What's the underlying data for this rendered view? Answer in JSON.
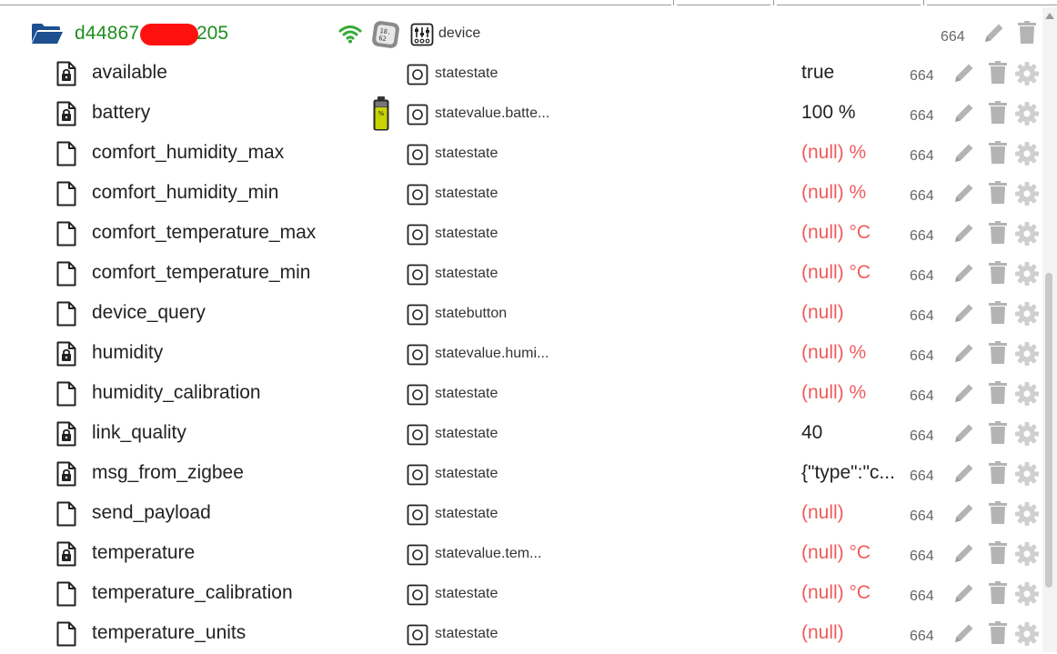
{
  "device": {
    "name_prefix": "d44867",
    "name_suffix": "205",
    "type_label": "device",
    "acl": "664",
    "icons": [
      "folder-open-icon",
      "wifi-icon",
      "sensor-display-icon",
      "device-type-icon",
      "edit-icon",
      "trash-icon"
    ],
    "colors": {
      "name": "#1f8f1f",
      "folder": "#1d4f91",
      "wifi": "#33aa33",
      "redaction": "#ff1010"
    }
  },
  "states": [
    {
      "name": "available",
      "locked": true,
      "role": "statestate",
      "value": "true",
      "value_null": false,
      "acl": "664"
    },
    {
      "name": "battery",
      "locked": true,
      "role": "statevalue.batte...",
      "value": "100 %",
      "value_null": false,
      "acl": "664",
      "icon": "battery-icon"
    },
    {
      "name": "comfort_humidity_max",
      "locked": false,
      "role": "statestate",
      "value": "(null) %",
      "value_null": true,
      "acl": "664"
    },
    {
      "name": "comfort_humidity_min",
      "locked": false,
      "role": "statestate",
      "value": "(null) %",
      "value_null": true,
      "acl": "664"
    },
    {
      "name": "comfort_temperature_max",
      "locked": false,
      "role": "statestate",
      "value": "(null) °C",
      "value_null": true,
      "acl": "664"
    },
    {
      "name": "comfort_temperature_min",
      "locked": false,
      "role": "statestate",
      "value": "(null) °C",
      "value_null": true,
      "acl": "664"
    },
    {
      "name": "device_query",
      "locked": false,
      "role": "statebutton",
      "value": "(null)",
      "value_null": true,
      "acl": "664"
    },
    {
      "name": "humidity",
      "locked": true,
      "role": "statevalue.humi...",
      "value": "(null) %",
      "value_null": true,
      "acl": "664"
    },
    {
      "name": "humidity_calibration",
      "locked": false,
      "role": "statestate",
      "value": "(null) %",
      "value_null": true,
      "acl": "664"
    },
    {
      "name": "link_quality",
      "locked": true,
      "role": "statestate",
      "value": "40",
      "value_null": false,
      "acl": "664"
    },
    {
      "name": "msg_from_zigbee",
      "locked": true,
      "role": "statestate",
      "value": "{\"type\":\"c...",
      "value_null": false,
      "acl": "664"
    },
    {
      "name": "send_payload",
      "locked": false,
      "role": "statestate",
      "value": "(null)",
      "value_null": true,
      "acl": "664"
    },
    {
      "name": "temperature",
      "locked": true,
      "role": "statevalue.tem...",
      "value": "(null) °C",
      "value_null": true,
      "acl": "664"
    },
    {
      "name": "temperature_calibration",
      "locked": false,
      "role": "statestate",
      "value": "(null) °C",
      "value_null": true,
      "acl": "664"
    },
    {
      "name": "temperature_units",
      "locked": false,
      "role": "statestate",
      "value": "(null)",
      "value_null": true,
      "acl": "664"
    }
  ],
  "row_icons": [
    "file-icon",
    "locked-file-icon",
    "state-role-icon",
    "edit-icon",
    "trash-icon",
    "gear-icon"
  ],
  "colors": {
    "null_value": "#ef5b5b",
    "action_icon": "#b4b4b4",
    "acl_text": "#666666"
  }
}
